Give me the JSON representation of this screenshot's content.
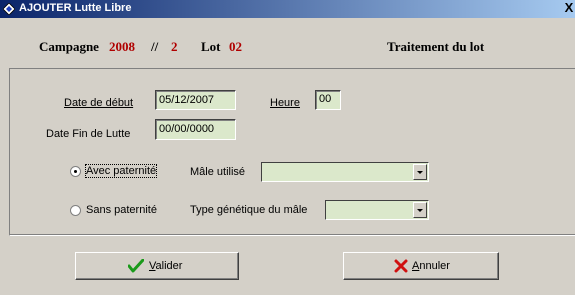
{
  "window": {
    "title": "AJOUTER Lutte Libre",
    "close_glyph": "X"
  },
  "header": {
    "campagne_label": "Campagne",
    "campagne_value": "2008",
    "separator": "//",
    "campagne_num": "2",
    "lot_label": "Lot",
    "lot_value": "02",
    "section_title": "Traitement du lot"
  },
  "form": {
    "date_debut_label": "Date de début",
    "date_debut_value": "05/12/2007",
    "heure_label": "Heure",
    "heure_value": "00",
    "date_fin_label": "Date Fin de Lutte",
    "date_fin_value": "00/00/0000",
    "avec_paternite_label": "Avec paternité",
    "avec_paternite_selected": true,
    "male_utilise_label": "Mâle utilisé",
    "male_utilise_value": "",
    "sans_paternite_label": "Sans paternité",
    "sans_paternite_selected": false,
    "type_genetique_label": "Type génétique du mâle",
    "type_genetique_value": ""
  },
  "buttons": {
    "valider_label": "Valider",
    "annuler_label": "Annuler"
  },
  "icons": {
    "title": "diamond-app-icon",
    "valider": "checkmark-icon",
    "annuler": "x-mark-icon",
    "dropdown": "chevron-down-icon"
  },
  "colors": {
    "title_start": "#0a246a",
    "title_end": "#a6caf0",
    "field_bg": "#dbe8cb",
    "accent_red": "#b00000",
    "check_green": "#1a9a1a",
    "cancel_red": "#d01010"
  }
}
